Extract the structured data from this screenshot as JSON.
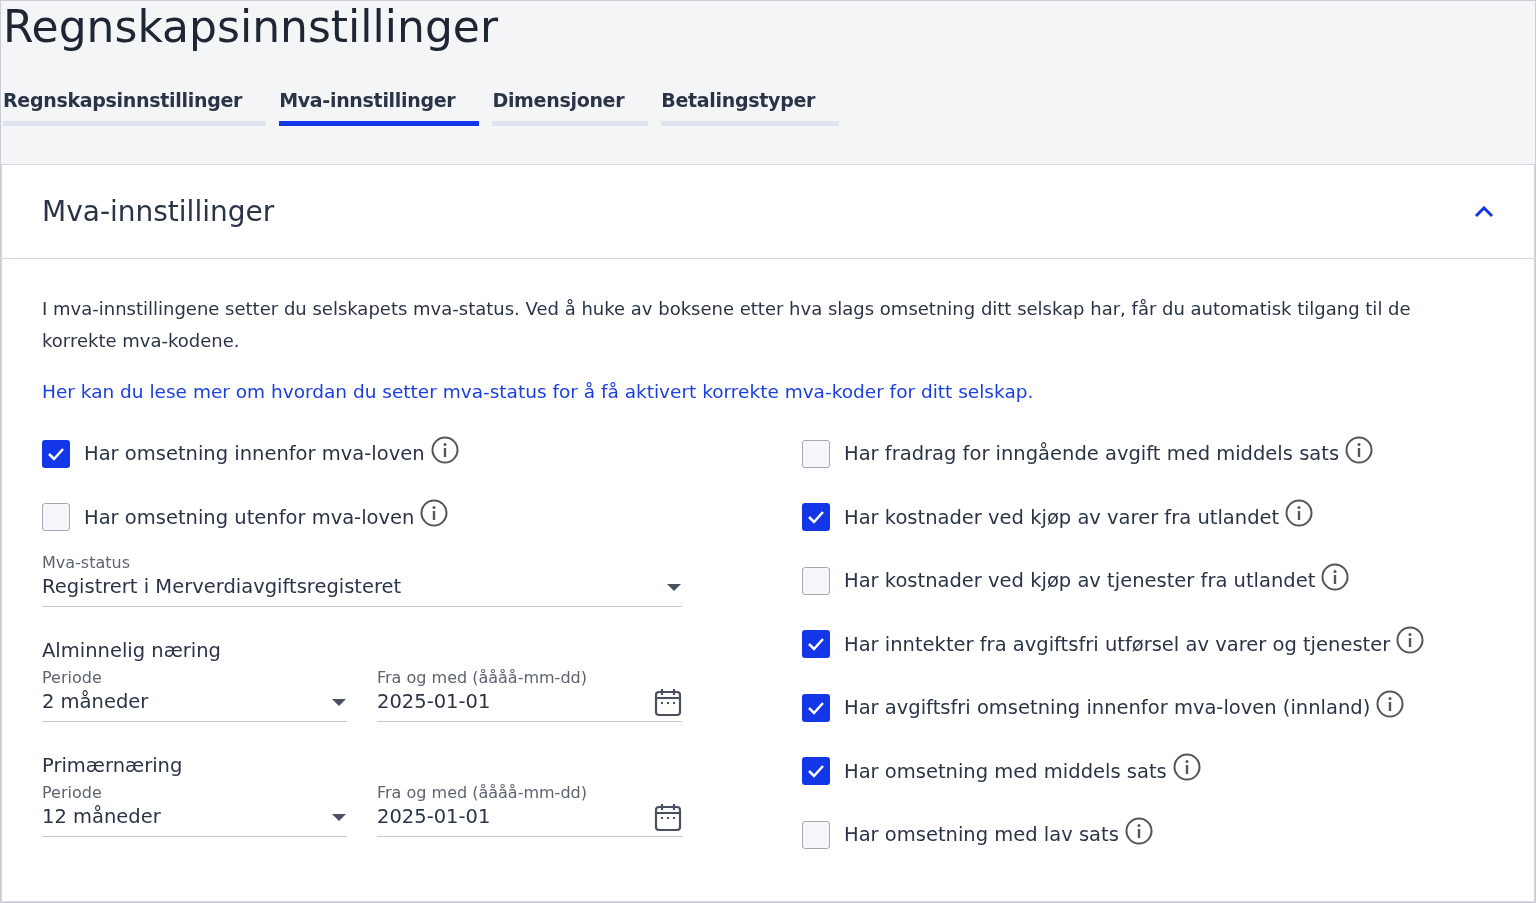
{
  "page_title": "Regnskapsinnstillinger",
  "tabs": [
    {
      "label": "Regnskapsinnstillinger",
      "selected": false
    },
    {
      "label": "Mva-innstillinger",
      "selected": true
    },
    {
      "label": "Dimensjoner",
      "selected": false
    },
    {
      "label": "Betalingstyper",
      "selected": false
    }
  ],
  "panel": {
    "title": "Mva-innstillinger",
    "expanded": true,
    "intro": "I mva-innstillingene setter du selskapets mva-status. Ved å huke av boksene etter hva slags omsetning ditt selskap har, får du automatisk tilgang til de korrekte mva-kodene.",
    "link": "Her kan du lese mer om hvordan du setter mva-status for å få aktivert korrekte mva-koder for ditt selskap.",
    "left_checkboxes": [
      {
        "label": "Har omsetning innenfor mva-loven",
        "checked": true
      },
      {
        "label": "Har omsetning utenfor mva-loven",
        "checked": false
      }
    ],
    "mva_status": {
      "label": "Mva-status",
      "value": "Registrert i Merverdiavgiftsregisteret"
    },
    "sections": [
      {
        "title": "Alminnelig næring",
        "period": {
          "label": "Periode",
          "value": "2 måneder"
        },
        "date": {
          "label": "Fra og med (åååå-mm-dd)",
          "value": "2025-01-01"
        }
      },
      {
        "title": "Primærnæring",
        "period": {
          "label": "Periode",
          "value": "12 måneder"
        },
        "date": {
          "label": "Fra og med (åååå-mm-dd)",
          "value": "2025-01-01"
        }
      }
    ],
    "right_checkboxes": [
      {
        "label": "Har fradrag for inngående avgift med middels sats",
        "checked": false
      },
      {
        "label": "Har kostnader ved kjøp av varer fra utlandet",
        "checked": true
      },
      {
        "label": "Har kostnader ved kjøp av tjenester fra utlandet",
        "checked": false
      },
      {
        "label": "Har inntekter fra avgiftsfri utførsel av varer og tjenester",
        "checked": true
      },
      {
        "label": "Har avgiftsfri omsetning innenfor mva-loven (innland)",
        "checked": true
      },
      {
        "label": "Har omsetning med middels sats",
        "checked": true
      },
      {
        "label": "Har omsetning med lav sats",
        "checked": false
      }
    ]
  }
}
